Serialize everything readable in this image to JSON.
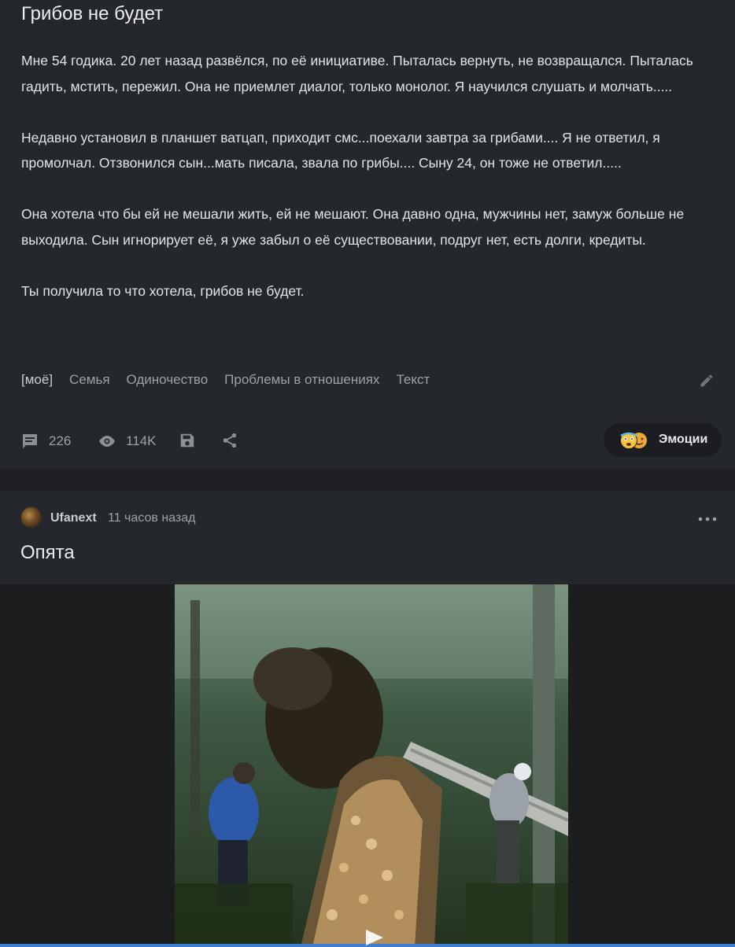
{
  "post1": {
    "title": "Грибов не будет",
    "paragraphs": [
      "Мне 54 годика. 20 лет назад развёлся, по её инициативе. Пыталась вернуть, не возвращался. Пыталась гадить, мстить, пережил. Она не приемлет диалог, только монолог. Я научился слушать и молчать.....",
      "Недавно установил в планшет ватцап, приходит смс...поехали завтра за грибами.... Я не ответил, я промолчал. Отзвонился сын...мать писала, звала по грибы.... Сыну 24, он тоже не ответил.....",
      "Она хотела что бы ей не мешали жить, ей не мешают. Она давно одна, мужчины нет, замуж больше не выходила. Сын игнорирует её, я уже забыл о её существовании, подруг нет, есть долги, кредиты.",
      "Ты получила то что хотела, грибов не будет."
    ],
    "tags": [
      "[моё]",
      "Семья",
      "Одиночество",
      "Проблемы в отношениях",
      "Текст"
    ],
    "comments_count": "226",
    "views_count": "114K",
    "emotions_label": "Эмоции"
  },
  "post2": {
    "author": "Ufanext",
    "time": "11 часов назад",
    "title": "Опята"
  },
  "colors": {
    "accent": "#3c7fd6",
    "card_bg": "#24272b",
    "page_bg": "#1e2024"
  }
}
